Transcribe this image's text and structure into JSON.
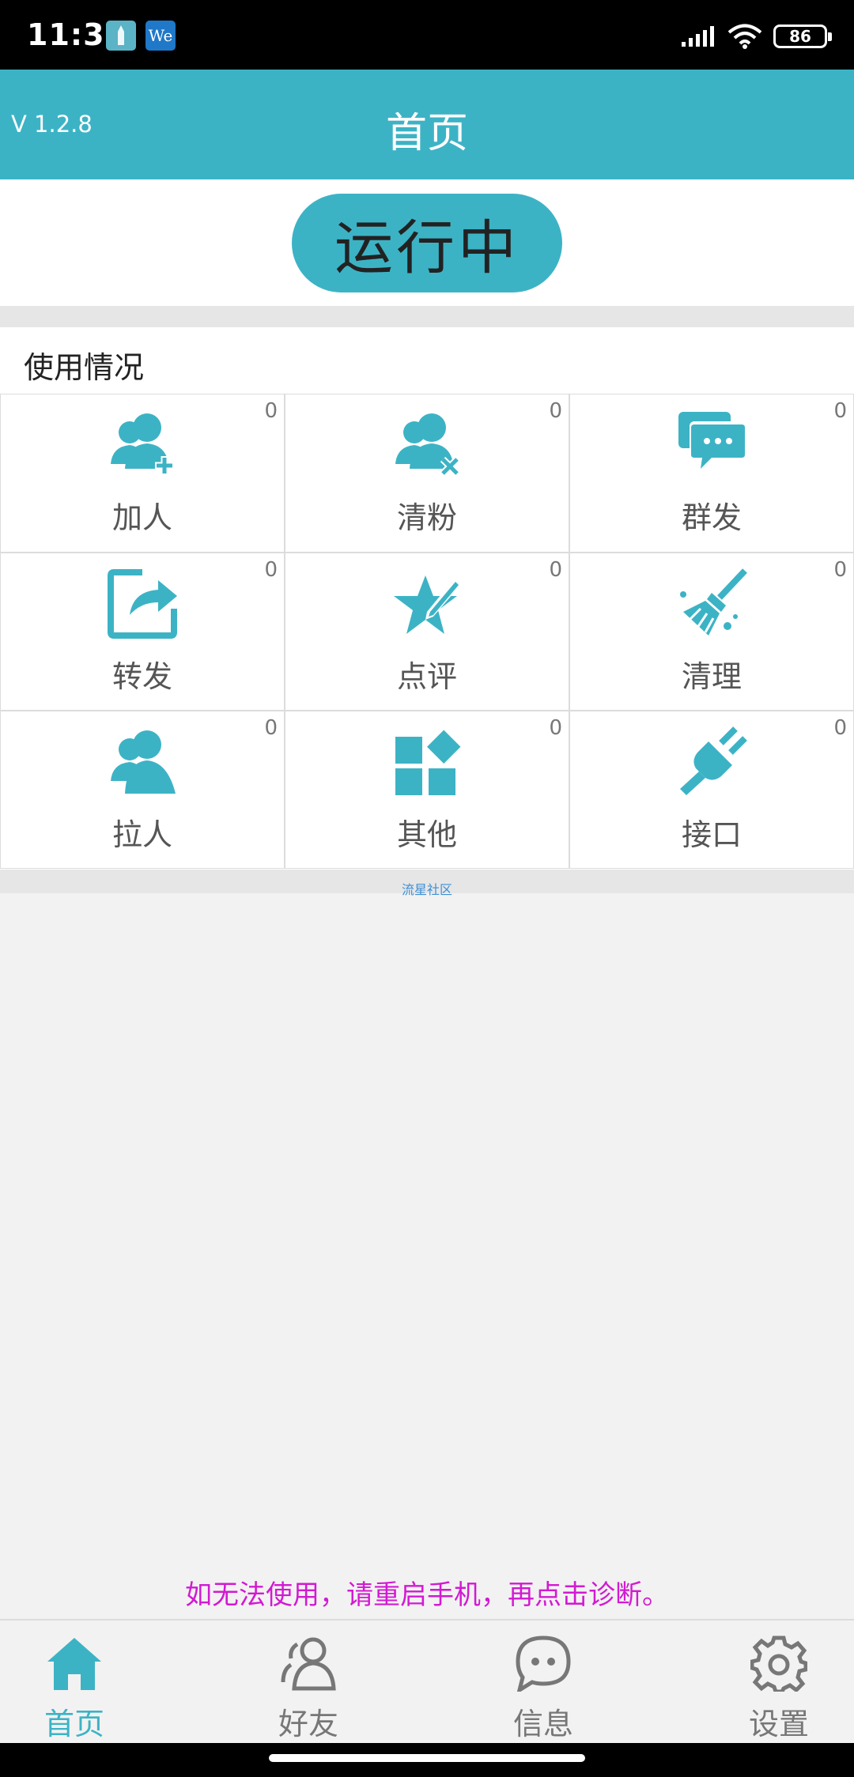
{
  "status_bar": {
    "time": "11:38",
    "app_icon_2_text": "We",
    "battery_level": "86"
  },
  "app_bar": {
    "version": "V 1.2.8",
    "title": "首页"
  },
  "run_button": {
    "label": "运行中"
  },
  "usage": {
    "title": "使用情况",
    "cells": [
      {
        "label": "加人",
        "count": "0",
        "icon": "add-user-icon"
      },
      {
        "label": "清粉",
        "count": "0",
        "icon": "remove-user-icon"
      },
      {
        "label": "群发",
        "count": "0",
        "icon": "chat-bubbles-icon"
      },
      {
        "label": "转发",
        "count": "0",
        "icon": "share-icon"
      },
      {
        "label": "点评",
        "count": "0",
        "icon": "star-pen-icon"
      },
      {
        "label": "清理",
        "count": "0",
        "icon": "broom-icon"
      },
      {
        "label": "拉人",
        "count": "0",
        "icon": "users-icon"
      },
      {
        "label": "其他",
        "count": "0",
        "icon": "apps-icon"
      },
      {
        "label": "接口",
        "count": "0",
        "icon": "plug-icon"
      }
    ]
  },
  "community_label": "流星社区",
  "notice": "如无法使用，请重启手机，再点击诊断。",
  "bottom_nav": {
    "items": [
      {
        "label": "首页",
        "icon": "home-icon",
        "active": true
      },
      {
        "label": "好友",
        "icon": "friends-icon",
        "active": false
      },
      {
        "label": "信息",
        "icon": "message-icon",
        "active": false
      },
      {
        "label": "设置",
        "icon": "settings-icon",
        "active": false
      }
    ]
  },
  "colors": {
    "accent": "#3cb3c5",
    "notice": "#d21ad2",
    "link": "#3d8fd6"
  }
}
